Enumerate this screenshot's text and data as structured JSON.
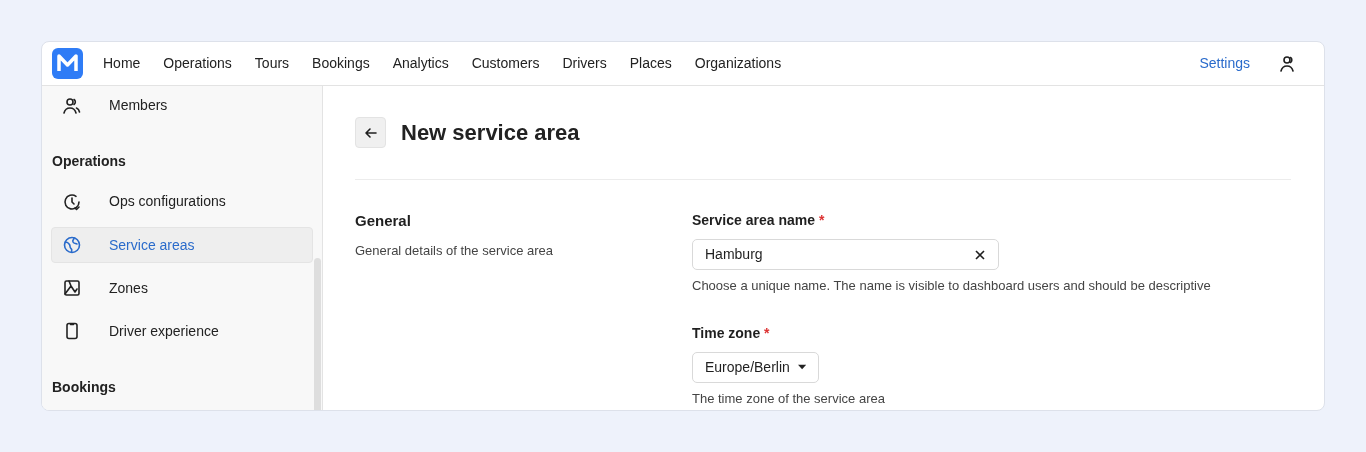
{
  "nav": {
    "items": [
      {
        "label": "Home",
        "selected": false
      },
      {
        "label": "Operations",
        "selected": false
      },
      {
        "label": "Tours",
        "selected": false
      },
      {
        "label": "Bookings",
        "selected": false
      },
      {
        "label": "Analytics",
        "selected": false
      },
      {
        "label": "Customers",
        "selected": false
      },
      {
        "label": "Drivers",
        "selected": false
      },
      {
        "label": "Places",
        "selected": false
      },
      {
        "label": "Organizations",
        "selected": false
      }
    ],
    "settings": {
      "label": "Settings",
      "selected": true
    }
  },
  "sidebar": {
    "items": [
      {
        "kind": "item",
        "label": "Members",
        "selected": false
      },
      {
        "kind": "section",
        "label": "Operations"
      },
      {
        "kind": "item",
        "label": "Ops configurations",
        "selected": false
      },
      {
        "kind": "item",
        "label": "Service areas",
        "selected": true
      },
      {
        "kind": "item",
        "label": "Zones",
        "selected": false
      },
      {
        "kind": "item",
        "label": "Driver experience",
        "selected": false
      },
      {
        "kind": "section",
        "label": "Bookings"
      }
    ]
  },
  "page": {
    "title": "New service area",
    "section": {
      "title": "General",
      "description": "General details of the service area"
    },
    "fields": [
      {
        "kind": "text",
        "label": "Service area name",
        "required_mark": "*",
        "value": "Hamburg",
        "help": "Choose a unique name. The name is visible to dashboard users and should be descriptive"
      },
      {
        "kind": "select",
        "label": "Time zone",
        "required_mark": "*",
        "value": "Europe/Berlin",
        "help": "The time zone of the service area"
      }
    ]
  }
}
